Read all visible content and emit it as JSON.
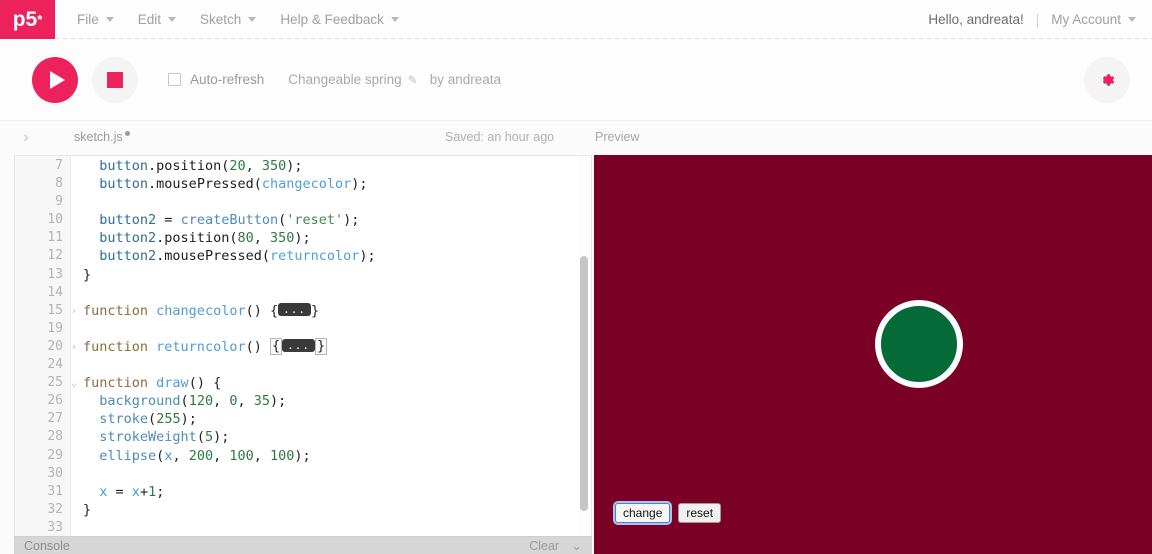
{
  "nav": {
    "logo": "p5",
    "logo_star": "*",
    "menus": [
      {
        "label": "File",
        "icon": "chevron-down-icon"
      },
      {
        "label": "Edit",
        "icon": "chevron-down-icon"
      },
      {
        "label": "Sketch",
        "icon": "chevron-down-icon"
      },
      {
        "label": "Help & Feedback",
        "icon": "chevron-down-icon"
      }
    ],
    "greeting": "Hello, andreata!",
    "separator": "|",
    "account": "My Account"
  },
  "toolbar": {
    "play_icon": "play-icon",
    "stop_icon": "stop-icon",
    "autorefresh_label": "Auto-refresh",
    "autorefresh_checked": false,
    "sketch_name": "Changeable spring",
    "edit_icon": "pencil-icon",
    "byline": "by andreata",
    "settings_icon": "gear-icon",
    "accent_color": "#ed225d"
  },
  "subbar": {
    "sidebar_toggle_icon": "chevron-right-icon",
    "filename": "sketch.js",
    "unsaved_indicator": "●",
    "saved_status": "Saved: an hour ago",
    "preview_label": "Preview"
  },
  "editor": {
    "lines": [
      {
        "n": "7",
        "fold": ""
      },
      {
        "n": "8",
        "fold": ""
      },
      {
        "n": "9",
        "fold": ""
      },
      {
        "n": "10",
        "fold": ""
      },
      {
        "n": "11",
        "fold": ""
      },
      {
        "n": "12",
        "fold": ""
      },
      {
        "n": "13",
        "fold": ""
      },
      {
        "n": "14",
        "fold": ""
      },
      {
        "n": "15",
        "fold": "›"
      },
      {
        "n": "19",
        "fold": ""
      },
      {
        "n": "20",
        "fold": "›"
      },
      {
        "n": "24",
        "fold": ""
      },
      {
        "n": "25",
        "fold": "⌄"
      },
      {
        "n": "26",
        "fold": ""
      },
      {
        "n": "27",
        "fold": ""
      },
      {
        "n": "28",
        "fold": ""
      },
      {
        "n": "29",
        "fold": ""
      },
      {
        "n": "30",
        "fold": ""
      },
      {
        "n": "31",
        "fold": ""
      },
      {
        "n": "32",
        "fold": ""
      },
      {
        "n": "33",
        "fold": ""
      }
    ],
    "code": {
      "l7_obj": "button",
      "l7_call": ".position(",
      "l7_a": "20",
      "l7_c1": ", ",
      "l7_b": "350",
      "l7_end": ");",
      "l8_obj": "button",
      "l8_call": ".mousePressed(",
      "l8_arg": "changecolor",
      "l8_end": ");",
      "l10_obj": "button2",
      "l10_eq": " = ",
      "l10_fn": "createButton",
      "l10_p1": "(",
      "l10_str": "'reset'",
      "l10_end": ");",
      "l11_obj": "button2",
      "l11_call": ".position(",
      "l11_a": "80",
      "l11_c1": ", ",
      "l11_b": "350",
      "l11_end": ");",
      "l12_obj": "button2",
      "l12_call": ".mousePressed(",
      "l12_arg": "returncolor",
      "l12_end": ");",
      "l13_brace": "}",
      "l15_kw": "function",
      "l15_name": "changecolor",
      "l15_paren": "()",
      "l15_open": "{",
      "l15_fold": "...",
      "l15_close": "}",
      "l20_kw": "function",
      "l20_name": "returncolor",
      "l20_paren": "()",
      "l20_open": "{",
      "l20_fold": "...",
      "l20_close": "}",
      "l25_kw": "function",
      "l25_name": "draw",
      "l25_rest": "() {",
      "l26_fn": "background",
      "l26_p": "(",
      "l26_a": "120",
      "l26_c1": ", ",
      "l26_b": "0",
      "l26_c2": ", ",
      "l26_c": "35",
      "l26_end": ");",
      "l27_fn": "stroke",
      "l27_p": "(",
      "l27_a": "255",
      "l27_end": ");",
      "l28_fn": "strokeWeight",
      "l28_p": "(",
      "l28_a": "5",
      "l28_end": ");",
      "l29_fn": "ellipse",
      "l29_p": "(",
      "l29_x": "x",
      "l29_c1": ", ",
      "l29_a": "200",
      "l29_c2": ", ",
      "l29_b": "100",
      "l29_c3": ", ",
      "l29_c": "100",
      "l29_end": ");",
      "l31_x": "x",
      "l31_eq": " = ",
      "l31_x2": "x",
      "l31_plus": "+",
      "l31_one": "1",
      "l31_end": ";",
      "l32_brace": "}"
    }
  },
  "console": {
    "title": "Console",
    "clear_label": "Clear",
    "chevron_icon": "chevron-down-icon"
  },
  "preview": {
    "background_color": "#7a0026",
    "circle_fill": "#046A38",
    "circle_stroke": "#ffffff",
    "buttons": [
      {
        "label": "change",
        "focused": true
      },
      {
        "label": "reset",
        "focused": false
      }
    ]
  }
}
